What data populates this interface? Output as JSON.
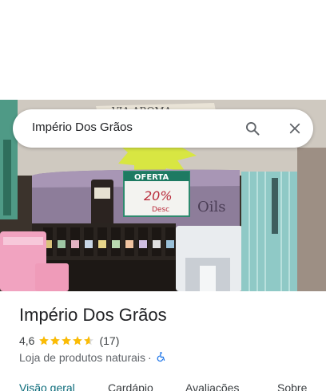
{
  "search": {
    "query": "Império Dos Grãos"
  },
  "place": {
    "name": "Império Dos Grãos",
    "rating": "4,6",
    "rating_value": 4.6,
    "review_count": "(17)",
    "category": "Loja de produtos naturais",
    "separator": "·"
  },
  "photo": {
    "sign_top": "VIA AROMA",
    "sign_offer": "OFERTA",
    "sign_discount": "20%",
    "sign_discount_suffix": "Desc",
    "sign_oils": "Oils"
  },
  "tabs": [
    {
      "label": "Visão geral",
      "active": true
    },
    {
      "label": "Cardápio"
    },
    {
      "label": "Avaliações"
    },
    {
      "label": "Sobre"
    }
  ],
  "colors": {
    "accent_tab": "#0b6b7a",
    "star": "#fbbc04",
    "accessibility": "#1a73e8"
  },
  "icons": {
    "search": "search-icon",
    "close": "close-icon",
    "accessibility": "wheelchair-icon"
  }
}
